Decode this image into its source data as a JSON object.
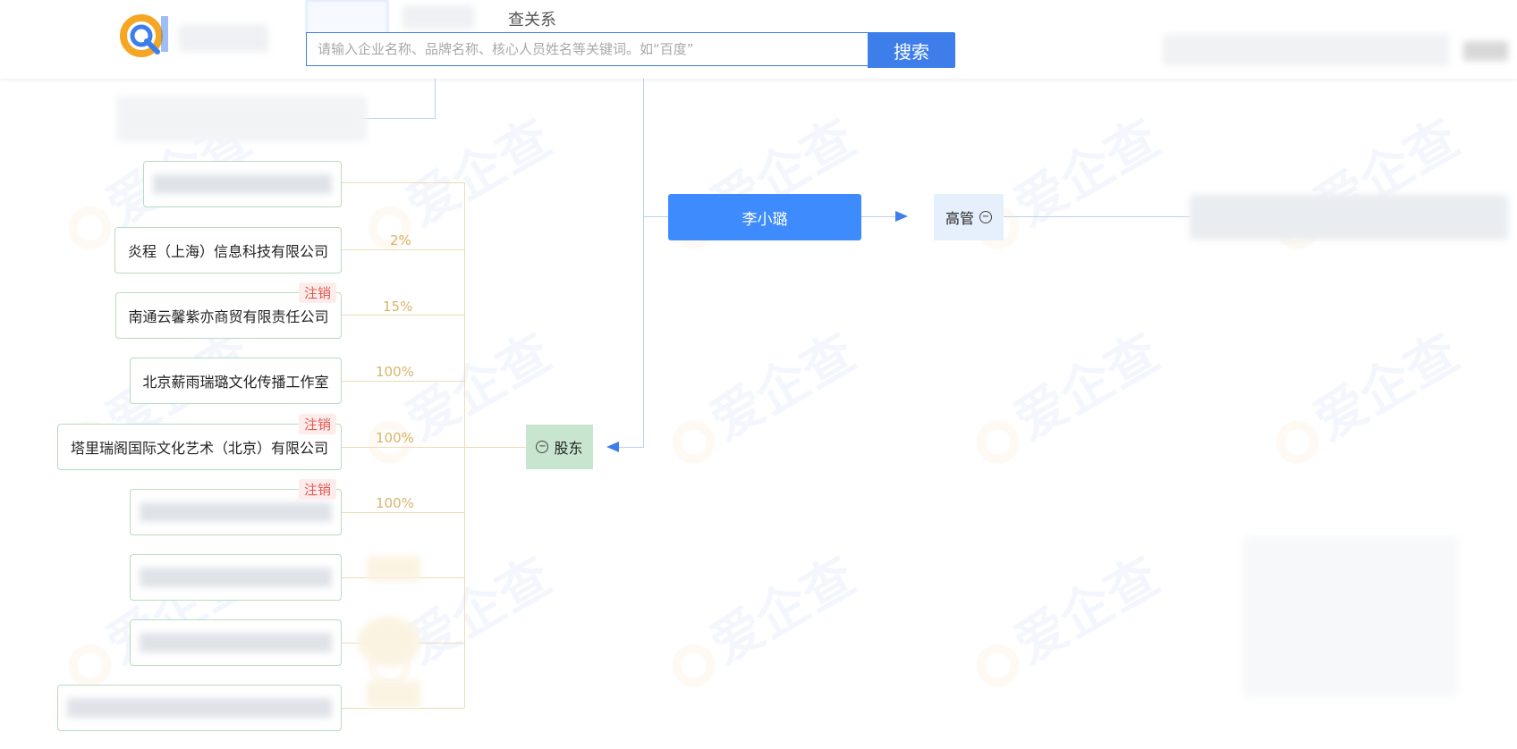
{
  "header": {
    "tab_label": "查关系",
    "search_placeholder": "请输入企业名称、品牌名称、核心人员姓名等关键词。如“百度”",
    "search_button": "搜索"
  },
  "watermark_text": "爱企查",
  "person": {
    "name": "李小璐"
  },
  "roles": {
    "executive_label": "高管",
    "shareholder_label": "股东"
  },
  "companies": [
    {
      "name": "炎程（上海）信息科技有限公司",
      "share": "2%",
      "status": ""
    },
    {
      "name": "南通云馨紫亦商贸有限责任公司",
      "share": "15%",
      "status": "注销"
    },
    {
      "name": "北京薪雨瑞璐文化传播工作室",
      "share": "100%",
      "status": ""
    },
    {
      "name": "塔里瑞阁国际文化艺术（北京）有限公司",
      "share": "100%",
      "status": "注销"
    },
    {
      "name": "",
      "share": "100%",
      "status": "注销"
    }
  ],
  "colors": {
    "accent": "#3d7eea",
    "person_node": "#3d8bfd",
    "shareholder_node": "#c8e6cf",
    "executive_node": "#e6f0fc",
    "cancel_tag": "#e05a4e",
    "share_pct": "#d9b36a"
  }
}
